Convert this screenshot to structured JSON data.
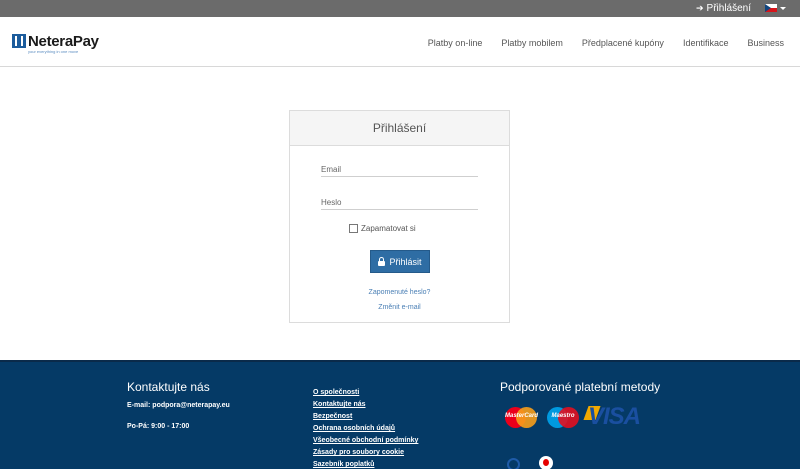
{
  "topbar": {
    "login_label": "Přihlášení",
    "language": "CZ"
  },
  "header": {
    "logo_name": "NeteraPay",
    "logo_tagline": "your everything in one move",
    "nav": [
      "Platby on-line",
      "Platby mobilem",
      "Předplacené kupóny",
      "Identifikace",
      "Business"
    ]
  },
  "login": {
    "title": "Přihlášení",
    "email_placeholder": "Email",
    "password_placeholder": "Heslo",
    "remember_label": "Zapamatovat si",
    "submit_label": "Přihlásit",
    "forgot_label": "Zapomenuté heslo?",
    "change_email_label": "Změnit e-mail"
  },
  "footer": {
    "contact_title": "Kontaktujte nás",
    "email_label": "E-mail:",
    "email_value": "podpora@neterapay.eu",
    "hours": "Po-Pá: 9:00 - 17:00",
    "links": [
      "O společnosti",
      "Kontaktujte nás",
      "Bezpečnost",
      "Ochrana osobních údajů",
      "Všeobecné obchodní podmínky",
      "Zásady pro soubory cookie",
      "Sazebník poplatků"
    ],
    "payment_title": "Podporované platební metody",
    "cards": {
      "mastercard": "MasterCard",
      "maestro": "Maestro",
      "visa": "VISA"
    }
  },
  "colors": {
    "topbar": "#6b6b6b",
    "footer": "#053a66",
    "button": "#2e6da4",
    "link": "#4a7fb5"
  }
}
